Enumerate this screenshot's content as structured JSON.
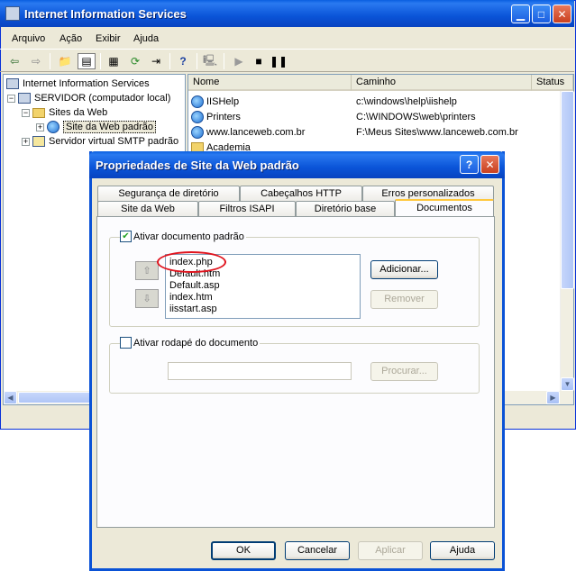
{
  "main_window": {
    "title": "Internet Information Services",
    "menu": [
      "Arquivo",
      "Ação",
      "Exibir",
      "Ajuda"
    ]
  },
  "tree": {
    "root": "Internet Information Services",
    "server": "SERVIDOR (computador local)",
    "sites_folder": "Sites da Web",
    "default_site": "Site da Web padrão",
    "smtp": "Servidor virtual SMTP padrão"
  },
  "list": {
    "headers": [
      "Nome",
      "Caminho",
      "Status"
    ],
    "rows": [
      {
        "name": "IISHelp",
        "path": "c:\\windows\\help\\iishelp"
      },
      {
        "name": "Printers",
        "path": "C:\\WINDOWS\\web\\printers"
      },
      {
        "name": "www.lanceweb.com.br",
        "path": "F:\\Meus Sites\\www.lanceweb.com.br"
      },
      {
        "name": "Academia",
        "path": ""
      }
    ]
  },
  "dialog": {
    "title": "Propriedades de Site da Web padrão",
    "tabs_row1": [
      "Segurança de diretório",
      "Cabeçalhos HTTP",
      "Erros personalizados"
    ],
    "tabs_row2": [
      "Site da Web",
      "Filtros ISAPI",
      "Diretório base",
      "Documentos"
    ],
    "enable_default_doc": "Ativar documento padrão",
    "default_docs": [
      "index.php",
      "Default.htm",
      "Default.asp",
      "index.htm",
      "iisstart.asp"
    ],
    "add_button": "Adicionar...",
    "remove_button": "Remover",
    "enable_footer": "Ativar rodapé do documento",
    "browse_button": "Procurar...",
    "ok_button": "OK",
    "cancel_button": "Cancelar",
    "apply_button": "Aplicar",
    "help_button": "Ajuda"
  },
  "colors": {
    "titlebar": "#0a54d8",
    "window_bg": "#ece9d8",
    "highlight_ellipse": "#e0141e"
  }
}
